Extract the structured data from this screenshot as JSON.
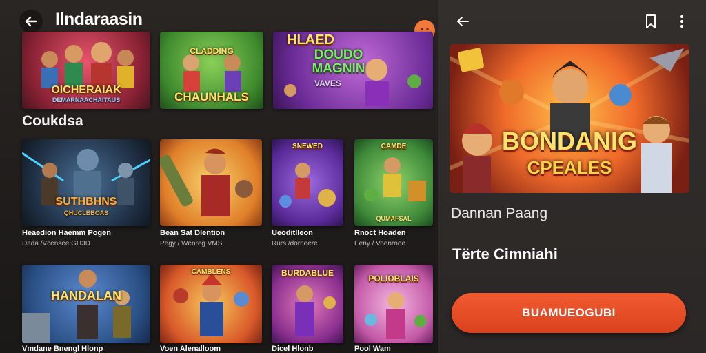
{
  "header": {
    "title": "Ilndaraasin"
  },
  "section": {
    "title": "Coukdsa"
  },
  "top_tiles": [
    {
      "title": "OICHERAIAK",
      "sub": "DEMARNAACHAITAUS"
    },
    {
      "title": "CHAUNHALS",
      "top": "CLADDING"
    },
    {
      "title": "DOUDO MAGNIN",
      "top": "HLAED",
      "sub": "VAVES"
    }
  ],
  "grid": [
    {
      "title": "SUTHBHNS",
      "sub": "QHUCLBBOAS",
      "caption": "Heaedion Haemm Pogen",
      "meta": "Dada /Vcensee GH3D"
    },
    {
      "title": "",
      "sub": "",
      "caption": "Bean Sat Dlention",
      "meta": "Pegy / Wenreg VMS"
    },
    {
      "title": "",
      "sub": "",
      "top": "SNEWED",
      "caption": "Ueoditlleon",
      "meta": "Rurs /dorneere"
    },
    {
      "title": "",
      "sub": "QUMAFSAL",
      "top": "CAMDE",
      "caption": "Rnoct Hoaden",
      "meta": "Eeny / Voenrooe"
    },
    {
      "title": "HANDALAN",
      "sub": "",
      "caption": "Vmdane Bnengl Hlonp",
      "meta": ""
    },
    {
      "title": "",
      "sub": "",
      "top": "CAMBLENS",
      "caption": "Voen Alenalloom",
      "meta": ""
    },
    {
      "title": "BURDABLUE",
      "sub": "",
      "caption": "Dicel Hlonb",
      "meta": ""
    },
    {
      "title": "POLIOBLAIS",
      "sub": "",
      "caption": "Pool Wam",
      "meta": ""
    }
  ],
  "detail": {
    "hero_title": "BONDANIG",
    "hero_sub": "CPEALES",
    "game_name": "Dannan Paang",
    "game_sub": "Tërte Cimniahi",
    "cta_label": "BUAMUEOGUBI"
  },
  "colors": {
    "accent": "#e5502a",
    "badge": "#f07a3a",
    "background": "#1f1c1b"
  }
}
